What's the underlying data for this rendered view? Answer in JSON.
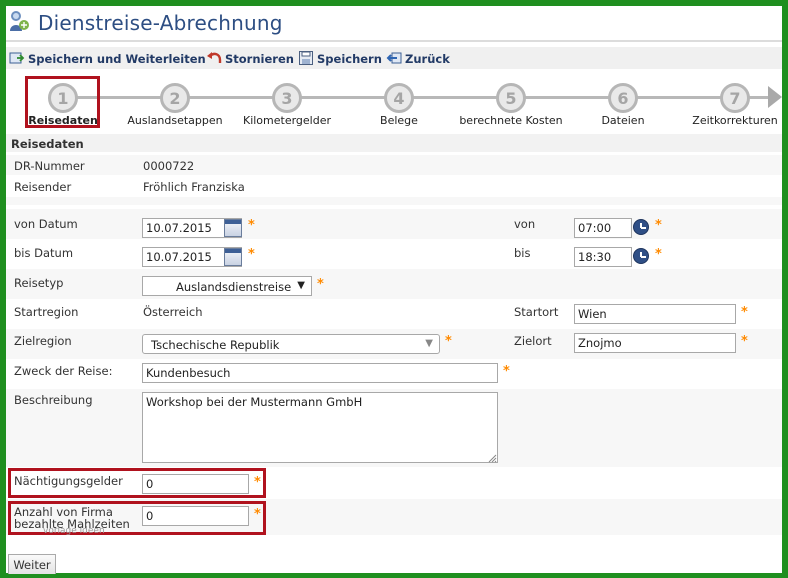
{
  "header": {
    "title": "Dienstreise-Abrechnung"
  },
  "toolbar": {
    "save_forward": "Speichern und Weiterleiten",
    "cancel": "Stornieren",
    "save": "Speichern",
    "back": "Zurück"
  },
  "stepper": {
    "steps": [
      {
        "number": "1",
        "label": "Reisedaten"
      },
      {
        "number": "2",
        "label": "Auslandsetappen"
      },
      {
        "number": "3",
        "label": "Kilometergelder"
      },
      {
        "number": "4",
        "label": "Belege"
      },
      {
        "number": "5",
        "label": "berechnete Kosten"
      },
      {
        "number": "6",
        "label": "Dateien"
      },
      {
        "number": "7",
        "label": "Zeitkorrekturen"
      }
    ]
  },
  "section": {
    "title": "Reisedaten"
  },
  "form": {
    "dr_number": {
      "label": "DR-Nummer",
      "value": "0000722"
    },
    "traveler": {
      "label": "Reisender",
      "value": "Fröhlich Franziska"
    },
    "from_date": {
      "label": "von Datum",
      "value": "10.07.2015"
    },
    "from_time": {
      "label": "von",
      "value": "07:00"
    },
    "to_date": {
      "label": "bis Datum",
      "value": "10.07.2015"
    },
    "to_time": {
      "label": "bis",
      "value": "18:30"
    },
    "trip_type": {
      "label": "Reisetyp",
      "value": "Auslandsdienstreise"
    },
    "start_region": {
      "label": "Startregion",
      "value": "Österreich"
    },
    "start_place": {
      "label": "Startort",
      "value": "Wien"
    },
    "target_region": {
      "label": "Zielregion",
      "value": "Tschechische Republik"
    },
    "target_place": {
      "label": "Zielort",
      "value": "Znojmo"
    },
    "purpose": {
      "label": "Zweck der Reise:",
      "value": "Kundenbesuch"
    },
    "description": {
      "label": "Beschreibung",
      "value": "Workshop bei der Mustermann GmbH"
    },
    "overnight": {
      "label": "Nächtigungsgelder",
      "value": "0"
    },
    "meals": {
      "label_line1": "Anzahl von Firma",
      "label_line2": "bezahlte Mahlzeiten",
      "value": "0"
    },
    "required_mark": "*"
  },
  "footer": {
    "next_button": "Weiter",
    "watermark": "vorlage ideen"
  },
  "colors": {
    "frame": "#1f8f1f",
    "highlight": "#b0121e",
    "title": "#2d4e83",
    "required": "#ff8a00"
  }
}
